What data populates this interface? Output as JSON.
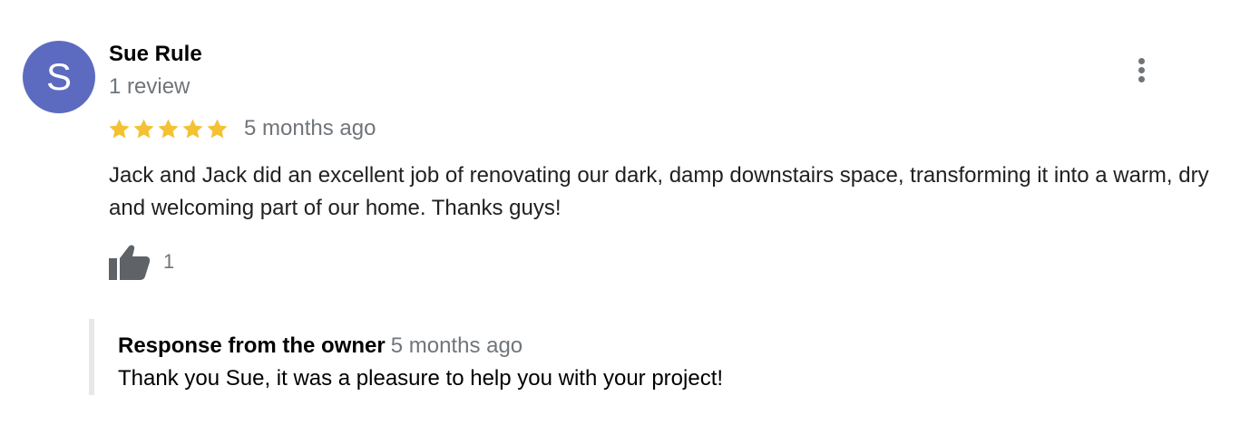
{
  "review": {
    "author": {
      "initial": "S",
      "name": "Sue Rule",
      "meta": "1 review",
      "avatar_color": "#5c6bc0"
    },
    "rating": 5,
    "rating_max": 5,
    "star_color": "#f4c132",
    "date": "5 months ago",
    "text": "Jack and Jack did an excellent job of renovating our dark, damp downstairs space, transforming it into a warm, dry and welcoming part of our home. Thanks guys!",
    "likes": "1",
    "more_icon": "more-vert-icon",
    "like_icon": "thumbs-up-icon"
  },
  "owner_response": {
    "title": "Response from the owner",
    "date": "5 months ago",
    "text": "Thank you Sue, it was a pleasure to help you with your project!"
  }
}
